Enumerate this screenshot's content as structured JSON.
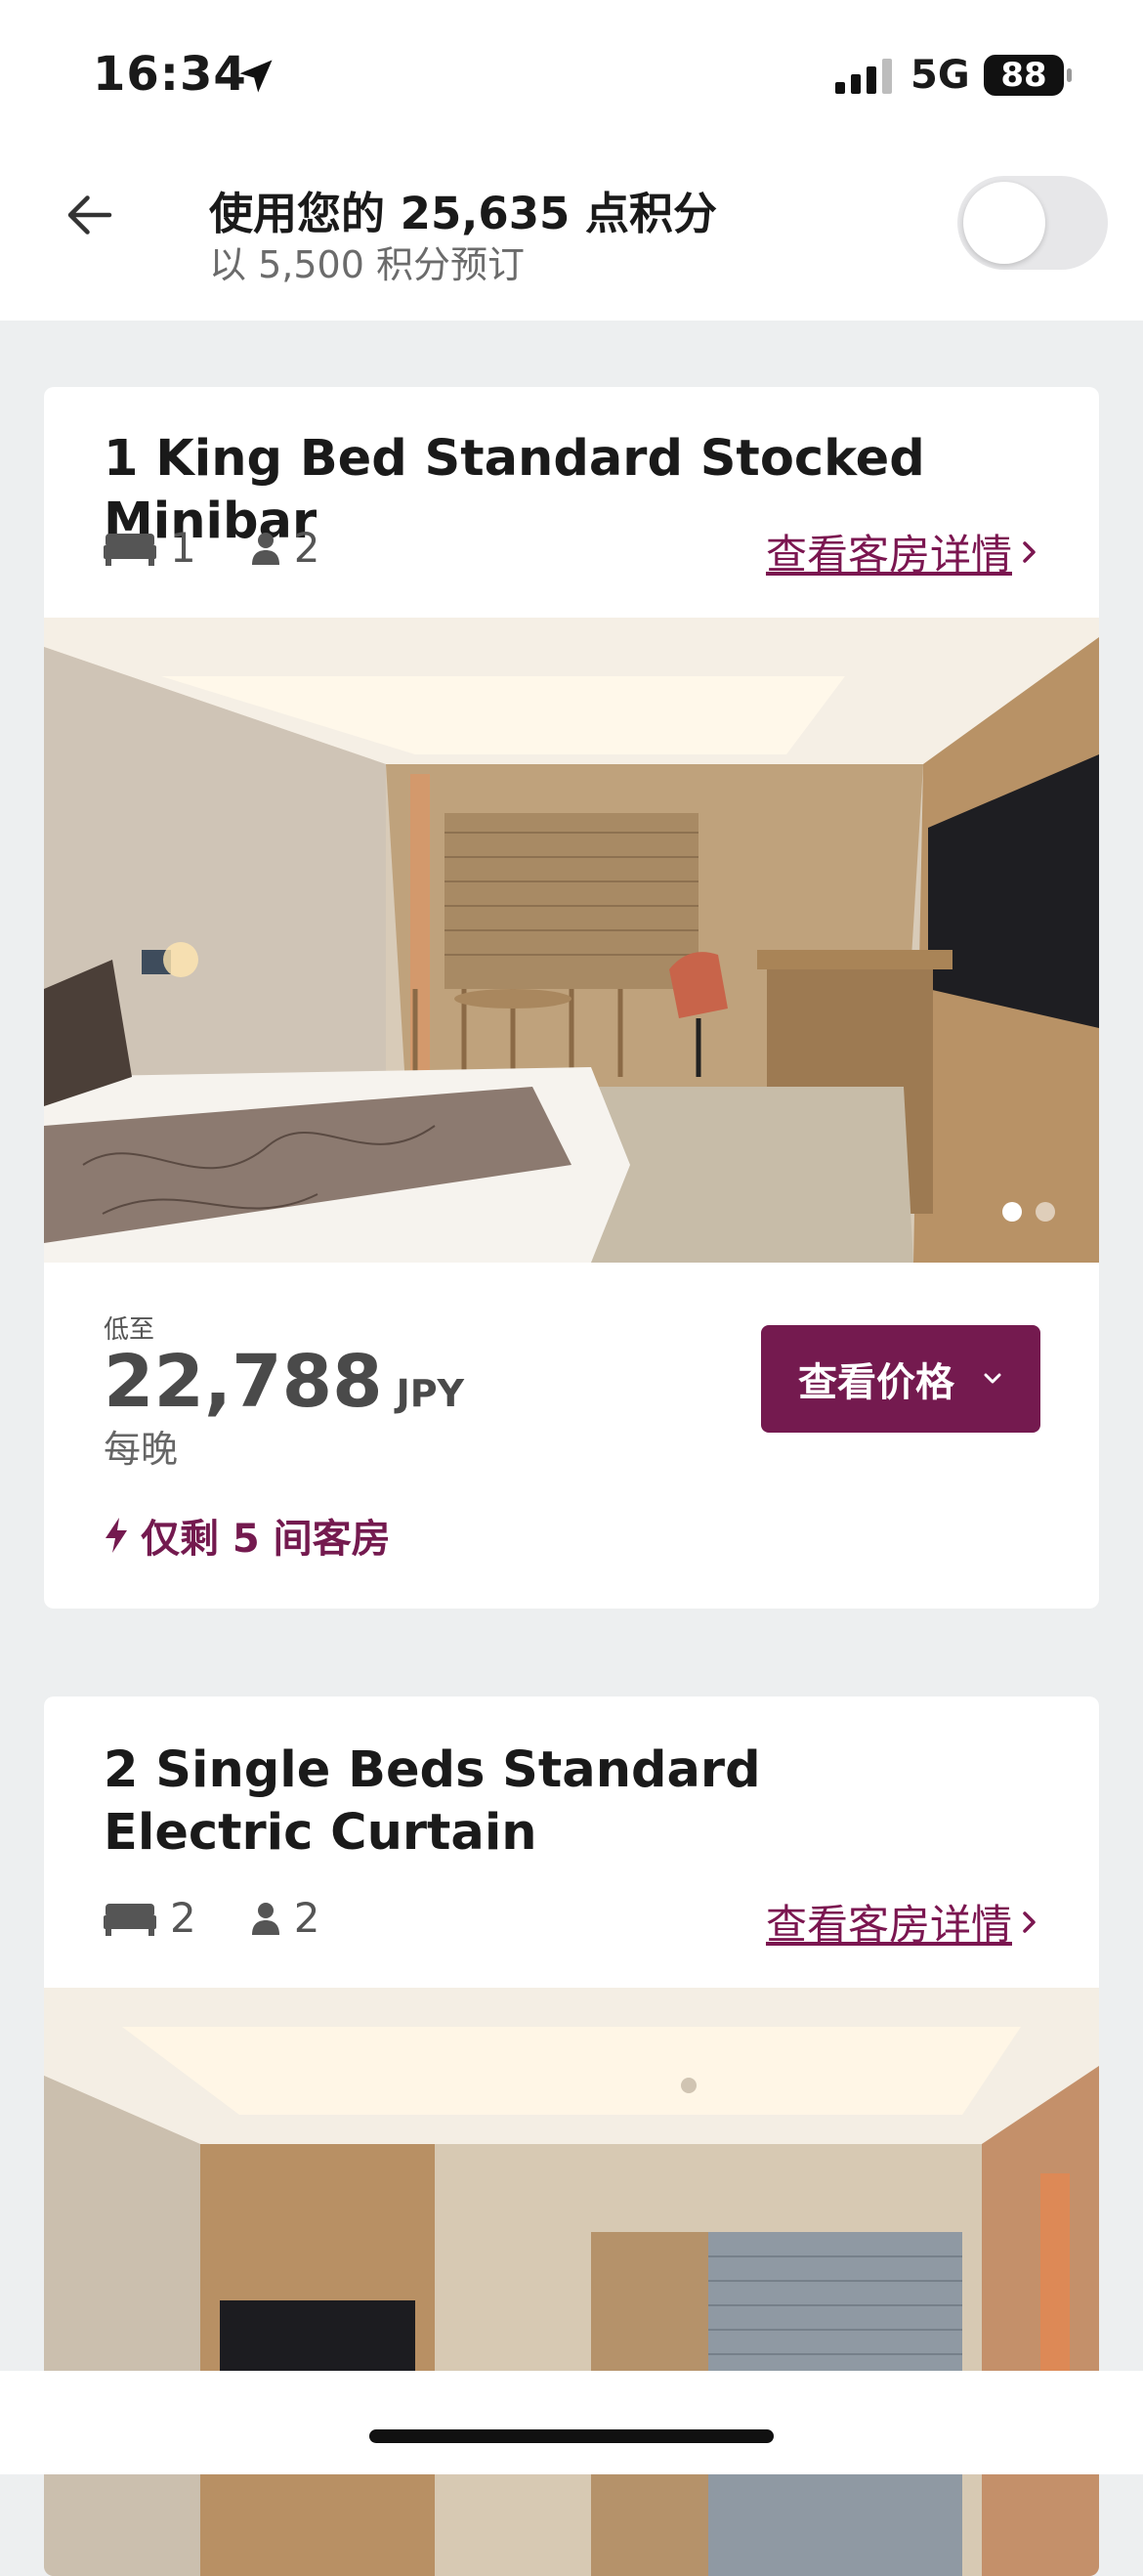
{
  "status_bar": {
    "time": "16:34",
    "network": "5G",
    "battery": "88",
    "location_icon": "location-arrow-icon",
    "signal_icon": "cellular-signal-icon"
  },
  "header": {
    "title": "使用您的 25,635 点积分",
    "subtitle": "以 5,500 积分预订",
    "back_icon": "back-arrow-icon",
    "toggle_on": false
  },
  "rooms": [
    {
      "name": "1 King Bed Standard Stocked Minibar",
      "beds": "1",
      "guests": "2",
      "details_link": "查看客房详情",
      "photo_count": 2,
      "photo_index": 1,
      "price_from_label": "低至",
      "price": "22,788",
      "currency": "JPY",
      "per_night": "每晚",
      "cta_label": "查看价格",
      "availability": "仅剩 5 间客房"
    },
    {
      "name": "2 Single Beds Standard Electric Curtain",
      "beds": "2",
      "guests": "2",
      "details_link": "查看客房详情"
    }
  ],
  "colors": {
    "brand": "#741a4f",
    "page_background": "#edeff0"
  }
}
